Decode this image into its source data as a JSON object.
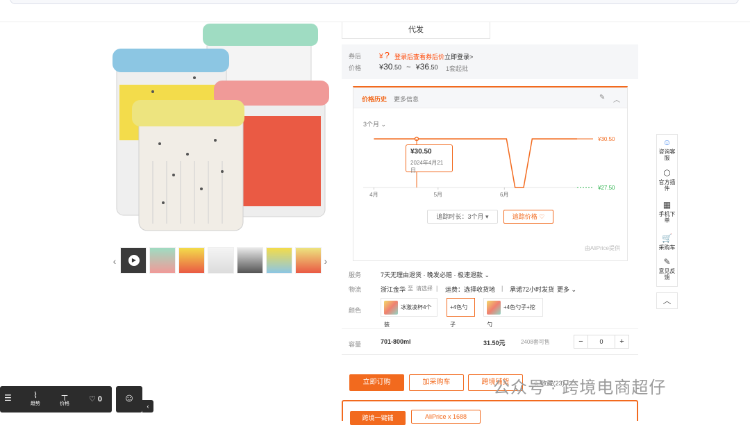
{
  "header": {
    "search_bar": ""
  },
  "gallery": {
    "thumbs": [
      "video",
      "img2",
      "img3",
      "img4",
      "img5",
      "img6",
      "img7"
    ]
  },
  "shipping_mode": "代发",
  "price": {
    "after_coupon_label": "券后",
    "price_label": "价格",
    "coupon_symbol": "¥",
    "coupon_q": "?",
    "coupon_text": "登录后查看券后价",
    "login_link": "立即登录>",
    "range_low_yen": "¥",
    "range_low_int": "30",
    "range_low_dec": ".50",
    "range_sep": "~",
    "range_high_yen": "¥",
    "range_high_int": "36",
    "range_high_dec": ".50",
    "moq": "1套起批"
  },
  "price_history": {
    "tab_active": "价格历史",
    "tab_more": "更多信息",
    "range": "3个月",
    "max_label": "¥30.50",
    "min_label": "¥27.50",
    "tooltip_price": "¥30.50",
    "tooltip_date": "2024年4月21日",
    "track_duration": "追踪时长：3个月",
    "track_button": "追踪价格 ♡",
    "source": "由AliPrice提供"
  },
  "chart_data": {
    "type": "line",
    "x_ticks": [
      "4月",
      "5月",
      "6月"
    ],
    "series": [
      {
        "x": [
          "2024-04-01",
          "2024-04-21",
          "2024-06-02",
          "2024-06-06",
          "2024-06-10",
          "2024-06-14",
          "2024-07-05"
        ],
        "values": [
          30.5,
          30.5,
          30.5,
          27.5,
          27.5,
          30.5,
          30.5
        ]
      }
    ],
    "ylim": [
      27.5,
      30.5
    ],
    "colors": {
      "line": "#f26a1e",
      "max": "#f26a1e",
      "min": "#2bb24c"
    }
  },
  "service": {
    "label": "服务",
    "value": "7天无理由退货 · 晚发必赔 · 极速退款 ⌄"
  },
  "logistics": {
    "label": "物流",
    "from": "浙江金华",
    "to": "至",
    "select": "请选择",
    "freight": "运费：选择收货地",
    "promise": "承诺72小时发货",
    "more": "更多 ⌄"
  },
  "color": {
    "label": "颜色",
    "options": [
      "冰激凌杯4个装",
      "+4色勺子",
      "+4色勺子+挖勺"
    ]
  },
  "capacity": {
    "label": "容量",
    "value": "701-800ml",
    "price": "31.50元",
    "stock": "2408套可售",
    "qty": "0",
    "minus": "−",
    "plus": "+"
  },
  "actions": {
    "order": "立即订购",
    "cart": "加采购车",
    "cross_border": "跨境铺货",
    "favorite": "☆ 收藏(23)"
  },
  "sidebar": {
    "items": [
      {
        "icon": "☺",
        "label": "咨询客服"
      },
      {
        "icon": "⬡",
        "label": "官方插件"
      },
      {
        "icon": "▦",
        "label": "手机下单"
      },
      {
        "icon": "🛒",
        "label": "采购车"
      },
      {
        "icon": "✎",
        "label": "意见反馈"
      }
    ],
    "up": "︿"
  },
  "bottom_tool": {
    "trend": "趋势",
    "price": "价格",
    "fav_count": "♡ 0"
  },
  "watermark": "公众号 · 跨境电商超仔",
  "cross_banner": {
    "left": "跨境一键铺",
    "right": "AliPrice x 1688"
  }
}
